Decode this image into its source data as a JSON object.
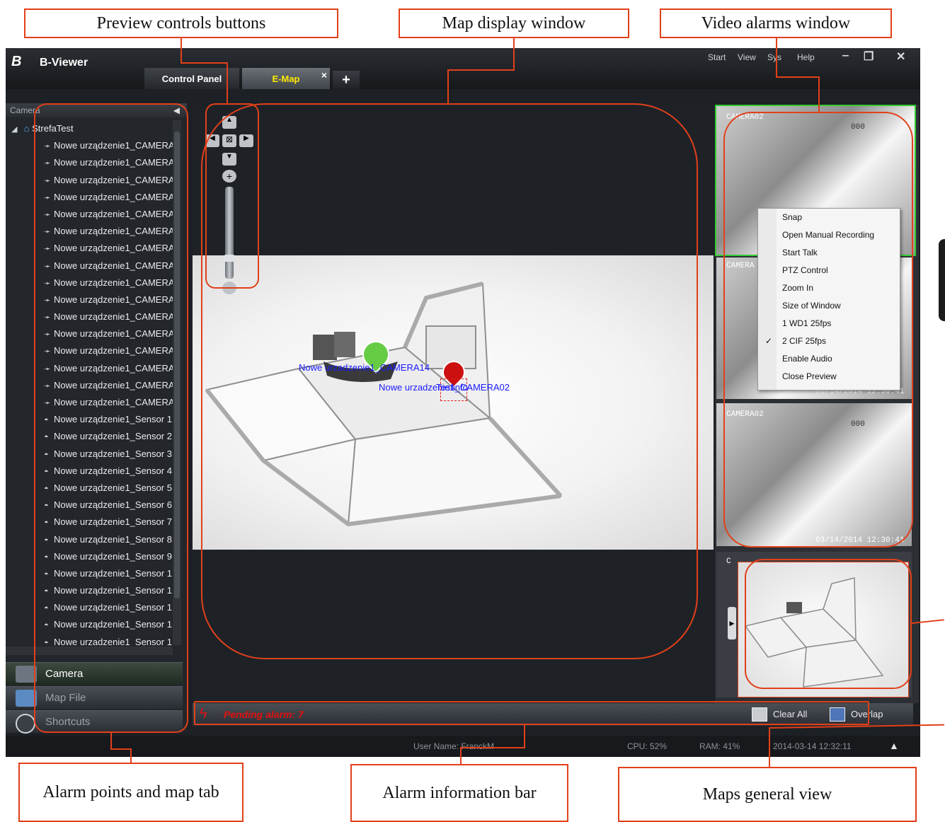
{
  "callouts": {
    "preview_controls": "Preview controls buttons",
    "map_display": "Map display window",
    "video_alarms": "Video alarms window",
    "alarm_points": "Alarm points and map tab",
    "alarm_info": "Alarm information bar",
    "maps_general": "Maps general view"
  },
  "window": {
    "logo": "B",
    "title": "B-Viewer",
    "menu": [
      "Start",
      "View",
      "Sys",
      "Help"
    ],
    "tabs": [
      {
        "label": "Control Panel",
        "active": false
      },
      {
        "label": "E-Map",
        "active": true
      }
    ],
    "tab_close": "×",
    "tab_add": "+"
  },
  "sidebar": {
    "header": "Camera",
    "root": "StrefaTest",
    "items": [
      "Nowe urządzenie1_CAMERA",
      "Nowe urządzenie1_CAMERA",
      "Nowe urządzenie1_CAMERA",
      "Nowe urządzenie1_CAMERA",
      "Nowe urządzenie1_CAMERA",
      "Nowe urządzenie1_CAMERA",
      "Nowe urządzenie1_CAMERA",
      "Nowe urządzenie1_CAMERA",
      "Nowe urządzenie1_CAMERA",
      "Nowe urządzenie1_CAMERA",
      "Nowe urządzenie1_CAMERA",
      "Nowe urządzenie1_CAMERA",
      "Nowe urządzenie1_CAMERA",
      "Nowe urządzenie1_CAMERA",
      "Nowe urządzenie1_CAMERA",
      "Nowe urządzenie1_CAMERA",
      "Nowe urządzenie1_Sensor 1",
      "Nowe urządzenie1_Sensor 2",
      "Nowe urządzenie1_Sensor 3",
      "Nowe urządzenie1_Sensor 4",
      "Nowe urządzenie1_Sensor 5",
      "Nowe urządzenie1_Sensor 6",
      "Nowe urządzenie1_Sensor 7",
      "Nowe urządzenie1_Sensor 8",
      "Nowe urządzenie1_Sensor 9",
      "Nowe urządzenie1_Sensor 1",
      "Nowe urządzenie1_Sensor 1",
      "Nowe urządzenie1_Sensor 1",
      "Nowe urządzenie1_Sensor 1",
      "Nowe urządzenie1_Sensor 1"
    ],
    "buttons": [
      "Camera",
      "Map File",
      "Shortcuts"
    ]
  },
  "map": {
    "marker1": "Nowe urzadzenie1_CAMERA14",
    "marker2": "Nowe urzadzenie1_CAMERA02",
    "marker2_overlay": "Testinfo"
  },
  "videos": {
    "label1": "CAMERA02",
    "label2": "CAMERA",
    "label3": "CAMERA02",
    "label4": "C",
    "door_number": "000",
    "timestamp": "03/14/2014 12:30:41"
  },
  "context_menu": [
    {
      "label": "Snap",
      "checked": false
    },
    {
      "label": "Open Manual Recording",
      "checked": false
    },
    {
      "label": "Start Talk",
      "checked": false
    },
    {
      "label": "PTZ Control",
      "checked": false
    },
    {
      "label": "Zoom In",
      "checked": false
    },
    {
      "label": "Size of Window",
      "checked": false
    },
    {
      "label": "1 WD1 25fps",
      "checked": false
    },
    {
      "label": "2 CIF 25fps",
      "checked": true
    },
    {
      "label": "Enable Audio",
      "checked": false
    },
    {
      "label": "Close Preview",
      "checked": false
    }
  ],
  "alarm_bar": {
    "pending": "Pending alarm: 7",
    "clear_all": "Clear All",
    "overlap": "Overlap"
  },
  "status": {
    "user": "User Name: FranckM",
    "cpu": "CPU: 52%",
    "ram": "RAM: 41%",
    "datetime": "2014-03-14 12:32:11"
  },
  "colors": {
    "accent": "#e2401a",
    "tab_active_text": "#ffea00",
    "alarm_text": "#e01010",
    "marker_text": "#1a1aff"
  }
}
